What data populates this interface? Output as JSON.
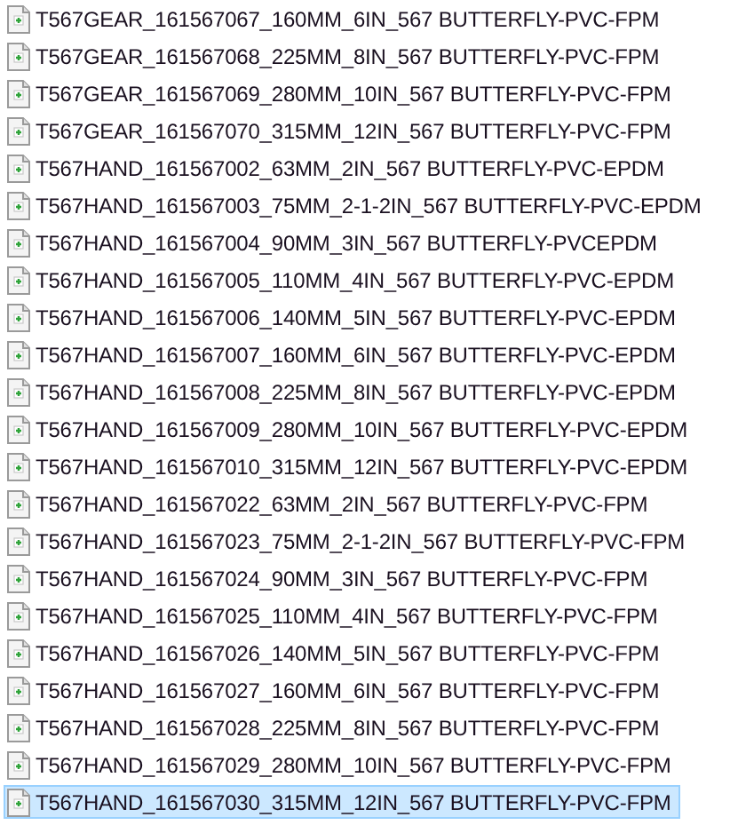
{
  "files": [
    {
      "name": "T567GEAR_161567067_160MM_6IN_567 BUTTERFLY-PVC-FPM",
      "selected": false
    },
    {
      "name": "T567GEAR_161567068_225MM_8IN_567 BUTTERFLY-PVC-FPM",
      "selected": false
    },
    {
      "name": "T567GEAR_161567069_280MM_10IN_567 BUTTERFLY-PVC-FPM",
      "selected": false
    },
    {
      "name": "T567GEAR_161567070_315MM_12IN_567 BUTTERFLY-PVC-FPM",
      "selected": false
    },
    {
      "name": "T567HAND_161567002_63MM_2IN_567 BUTTERFLY-PVC-EPDM",
      "selected": false
    },
    {
      "name": "T567HAND_161567003_75MM_2-1-2IN_567 BUTTERFLY-PVC-EPDM",
      "selected": false
    },
    {
      "name": "T567HAND_161567004_90MM_3IN_567 BUTTERFLY-PVCEPDM",
      "selected": false
    },
    {
      "name": "T567HAND_161567005_110MM_4IN_567 BUTTERFLY-PVC-EPDM",
      "selected": false
    },
    {
      "name": "T567HAND_161567006_140MM_5IN_567 BUTTERFLY-PVC-EPDM",
      "selected": false
    },
    {
      "name": "T567HAND_161567007_160MM_6IN_567 BUTTERFLY-PVC-EPDM",
      "selected": false
    },
    {
      "name": "T567HAND_161567008_225MM_8IN_567 BUTTERFLY-PVC-EPDM",
      "selected": false
    },
    {
      "name": "T567HAND_161567009_280MM_10IN_567 BUTTERFLY-PVC-EPDM",
      "selected": false
    },
    {
      "name": "T567HAND_161567010_315MM_12IN_567 BUTTERFLY-PVC-EPDM",
      "selected": false
    },
    {
      "name": "T567HAND_161567022_63MM_2IN_567 BUTTERFLY-PVC-FPM",
      "selected": false
    },
    {
      "name": "T567HAND_161567023_75MM_2-1-2IN_567 BUTTERFLY-PVC-FPM",
      "selected": false
    },
    {
      "name": "T567HAND_161567024_90MM_3IN_567 BUTTERFLY-PVC-FPM",
      "selected": false
    },
    {
      "name": "T567HAND_161567025_110MM_4IN_567 BUTTERFLY-PVC-FPM",
      "selected": false
    },
    {
      "name": "T567HAND_161567026_140MM_5IN_567 BUTTERFLY-PVC-FPM",
      "selected": false
    },
    {
      "name": "T567HAND_161567027_160MM_6IN_567 BUTTERFLY-PVC-FPM",
      "selected": false
    },
    {
      "name": "T567HAND_161567028_225MM_8IN_567 BUTTERFLY-PVC-FPM",
      "selected": false
    },
    {
      "name": "T567HAND_161567029_280MM_10IN_567 BUTTERFLY-PVC-FPM",
      "selected": false
    },
    {
      "name": "T567HAND_161567030_315MM_12IN_567 BUTTERFLY-PVC-FPM",
      "selected": true
    }
  ]
}
